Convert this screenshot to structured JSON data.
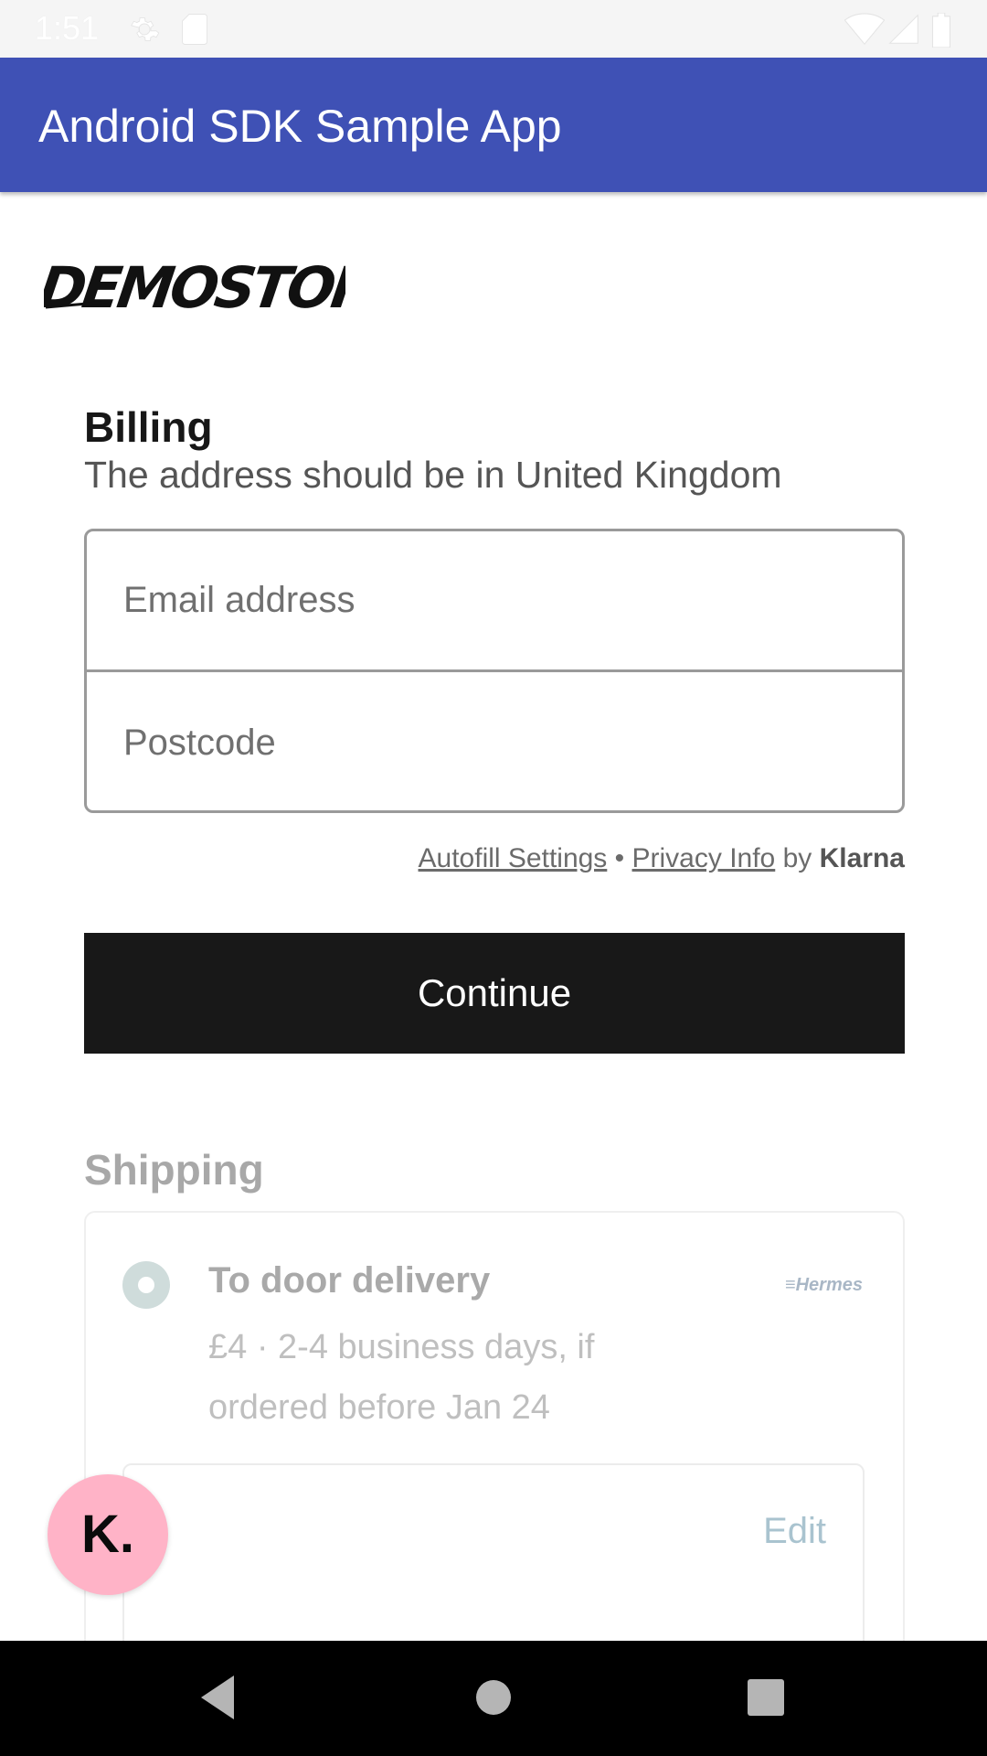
{
  "status_bar": {
    "time": "1:51",
    "icons": [
      "settings-icon",
      "sd-card-icon",
      "wifi-icon",
      "signal-icon",
      "battery-icon"
    ]
  },
  "app_bar": {
    "title": "Android SDK Sample App",
    "color": "#3f51b5"
  },
  "logo": {
    "text": "DEMOSTORE"
  },
  "billing": {
    "heading": "Billing",
    "subtitle": "The address should be in United Kingdom",
    "email_placeholder": "Email address",
    "email_value": "",
    "postcode_placeholder": "Postcode",
    "postcode_value": ""
  },
  "klarna_links": {
    "autofill": "Autofill Settings",
    "separator": "•",
    "privacy": "Privacy Info",
    "by": "by",
    "brand": "Klarna"
  },
  "continue_button": {
    "label": "Continue",
    "color": "#181818"
  },
  "shipping": {
    "heading": "Shipping",
    "option": {
      "title": "To door delivery",
      "detail": "£4 · 2-4 business days, if ordered before Jan 24",
      "carrier": "Hermes",
      "selected": true
    },
    "edit_label": "Edit"
  },
  "klarna_fab": {
    "label": "K.",
    "color": "#ffb3c7"
  },
  "nav_bar": {
    "buttons": [
      "back-icon",
      "home-icon",
      "recents-icon"
    ]
  }
}
